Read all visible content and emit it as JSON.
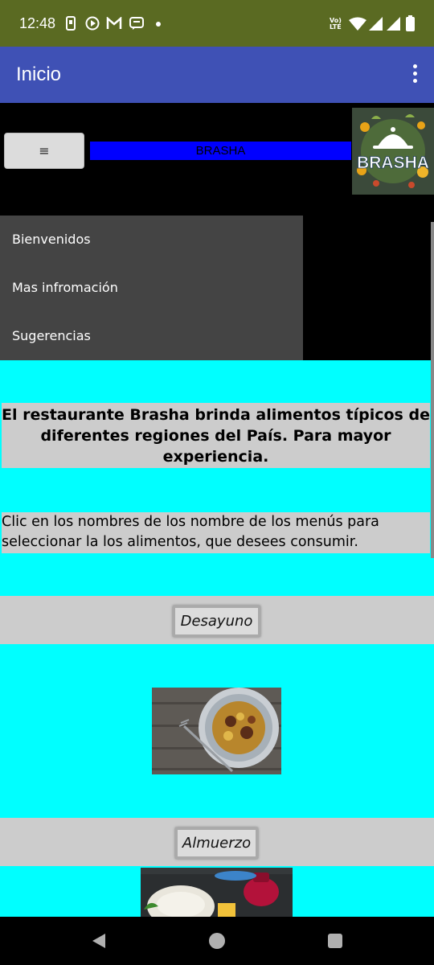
{
  "status_bar": {
    "time": "12:48",
    "network": "Vo) LTE"
  },
  "app_bar": {
    "title": "Inicio"
  },
  "header": {
    "menu_label": "≡",
    "brand": "BRASHA",
    "logo_text": "BRASHA"
  },
  "nav_menu": {
    "items": [
      {
        "label": "Bienvenidos"
      },
      {
        "label": "Mas infromación"
      },
      {
        "label": "Sugerencias"
      }
    ]
  },
  "intro": {
    "headline": "El restaurante Brasha brinda alimentos típicos de diferentes regiones del País. Para mayor experiencia.",
    "instruction": "Clic en los nombres de los nombre de los menús para seleccionar la los alimentos, que desees consumir."
  },
  "menus": [
    {
      "label": "Desayuno"
    },
    {
      "label": "Almuerzo"
    }
  ],
  "colors": {
    "status_bar": "#5a6a22",
    "app_bar": "#3f51b5",
    "page_background": "#00ffff",
    "brand_bar": "#0000ff",
    "nav_menu": "#444444",
    "text_box": "#cccccc"
  }
}
